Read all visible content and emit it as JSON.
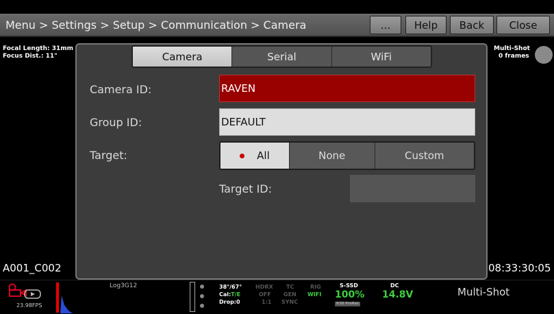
{
  "topbar": {
    "breadcrumb": "Menu > Settings > Setup > Communication > Camera",
    "buttons": {
      "more": "...",
      "help": "Help",
      "back": "Back",
      "close": "Close"
    }
  },
  "overlay": {
    "focal_length": "Focal Length: 31mm",
    "focus_dist": "Focus Dist.: 11\"",
    "multishot_label": "Multi-Shot",
    "multishot_frames": "0 frames",
    "clip_name": "A001_C002",
    "timecode": "08:33:30:05"
  },
  "dialog": {
    "tabs": [
      "Camera",
      "Serial",
      "WiFi"
    ],
    "active_tab": "Camera",
    "camera_id_label": "Camera ID:",
    "camera_id_value": "RAVEN",
    "group_id_label": "Group ID:",
    "group_id_value": "DEFAULT",
    "target_label": "Target:",
    "target_options": [
      "All",
      "None",
      "Custom"
    ],
    "target_selected": "All",
    "target_id_label": "Target ID:",
    "target_id_value": ""
  },
  "status": {
    "fps": "23.98FPS",
    "look": "Log3G12",
    "temp": "38°/67°",
    "cal_prefix": "Cal:",
    "cal_value": "T/E",
    "drop": "Drop:0",
    "hdrx": "HDRX",
    "hdrx_val": "OFF",
    "hdrx_ratio": "1:1",
    "tc": "TC",
    "tc_val": "GEN",
    "tc_sync": "SYNC",
    "rig": "RIG",
    "wifi": "WIFI",
    "media_label": "S-SSD",
    "media_pct": "100%",
    "media_badge": "R3D ProRes",
    "power_label": "DC",
    "power_value": "14.8V",
    "mode": "Multi-Shot"
  },
  "colors": {
    "accent_red": "#990000",
    "status_green": "#3fce3f"
  }
}
